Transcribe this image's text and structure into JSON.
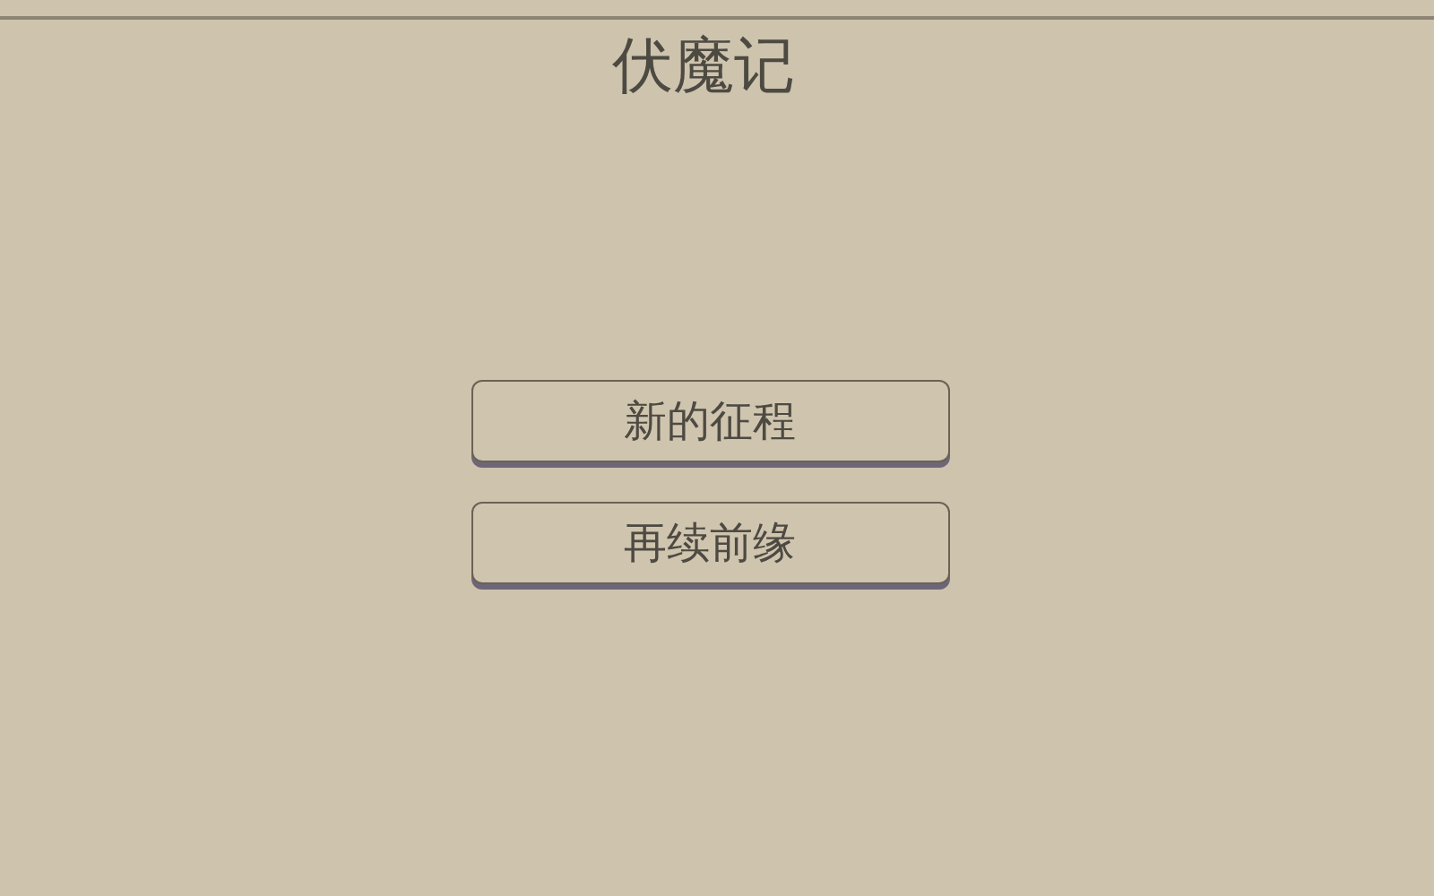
{
  "title": "伏魔记",
  "menu": [
    {
      "label": "新的征程"
    },
    {
      "label": "再续前缘"
    }
  ]
}
